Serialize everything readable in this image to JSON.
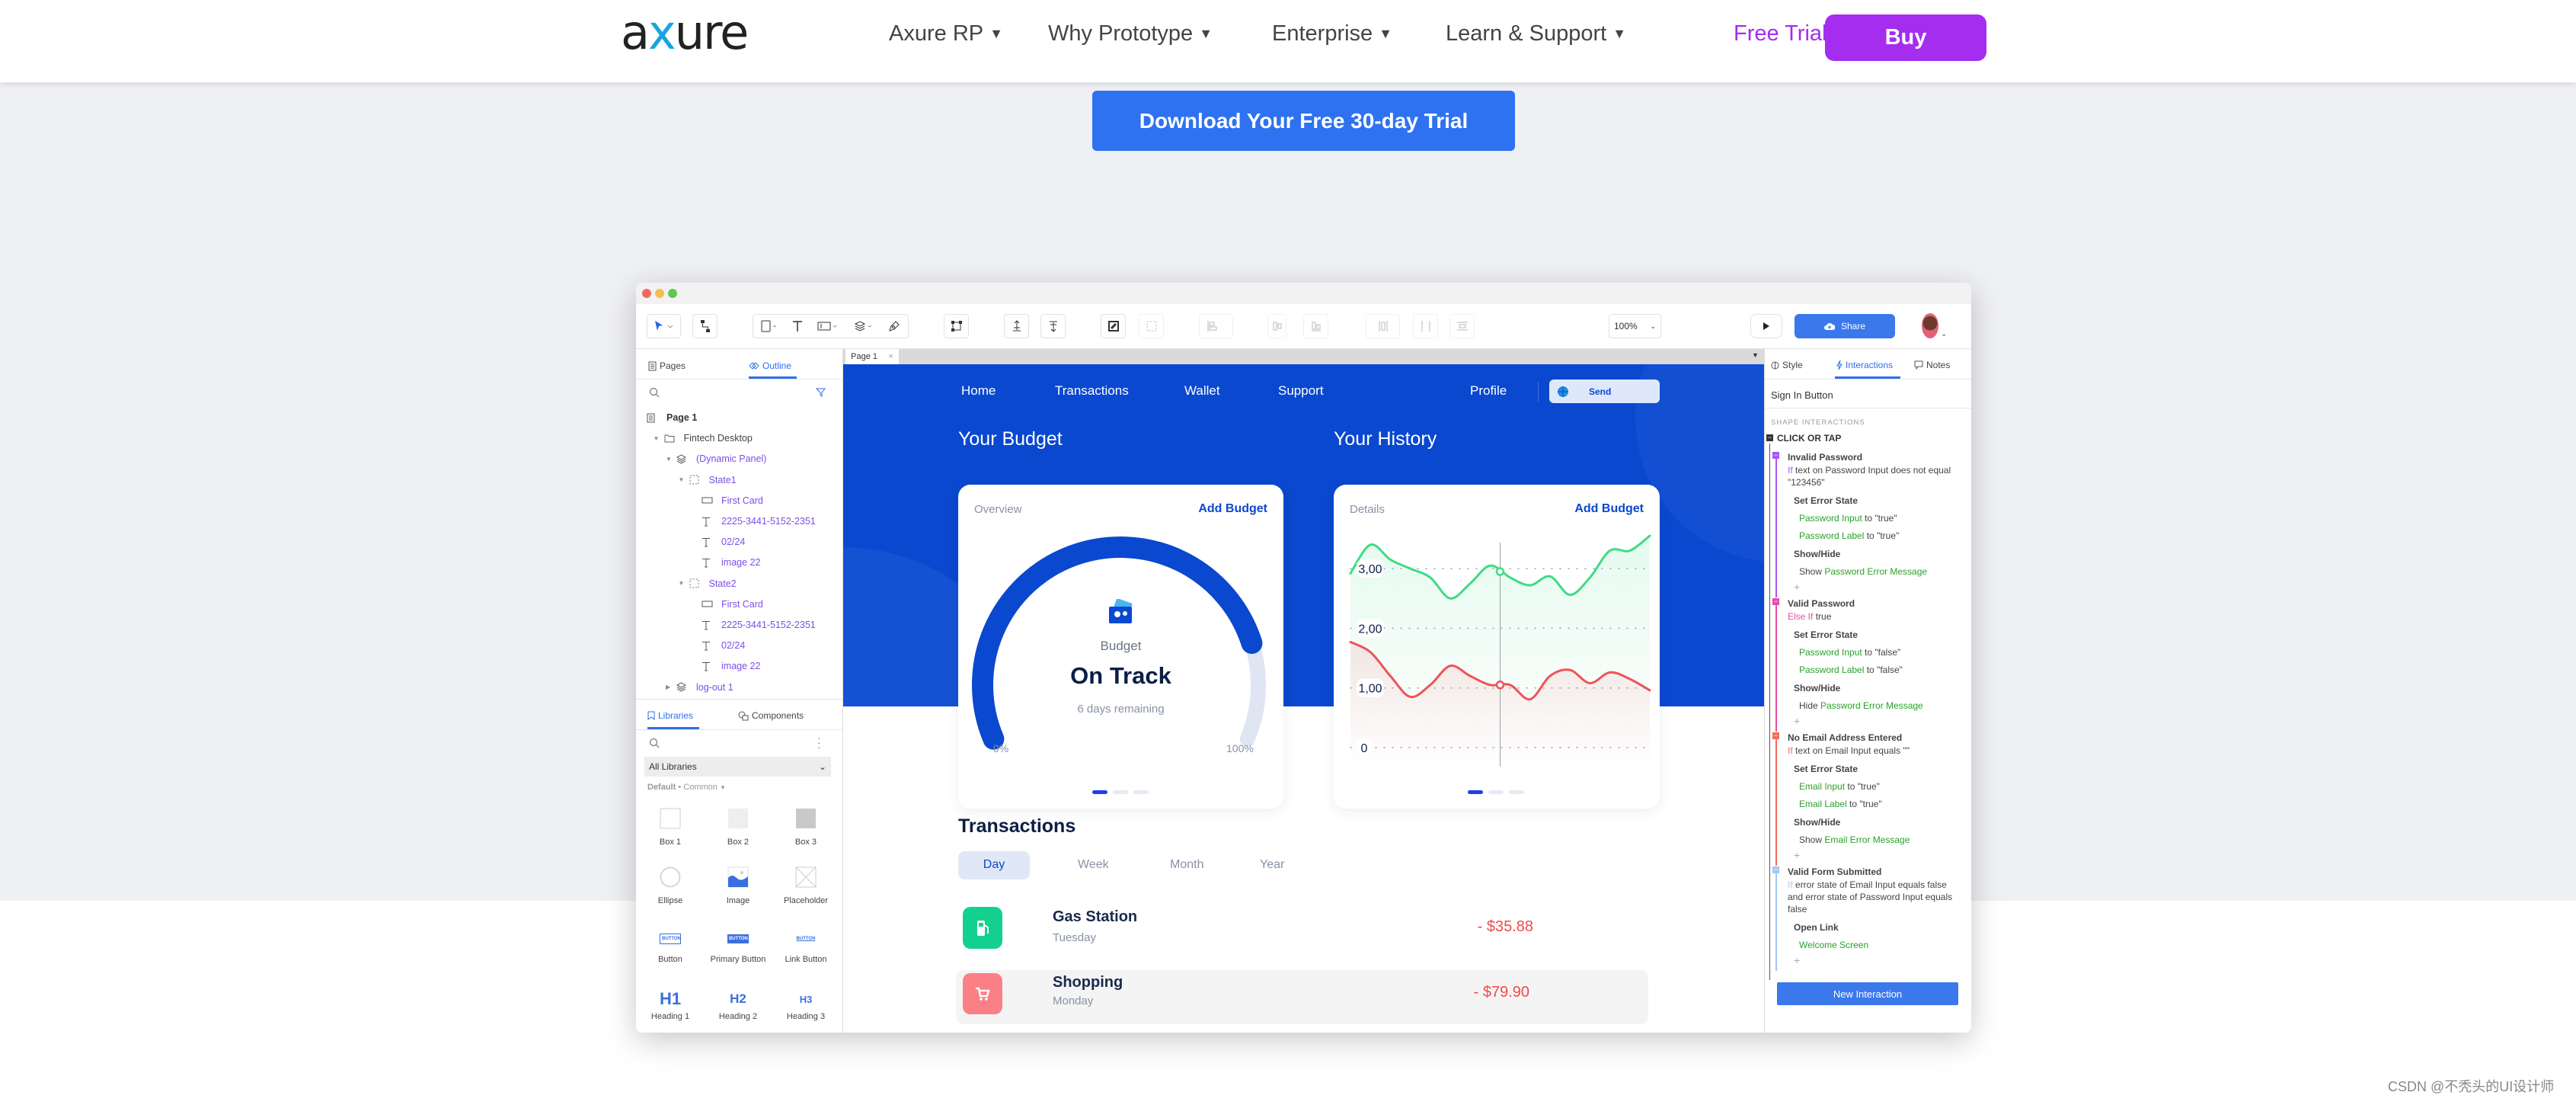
{
  "site": {
    "logo": "axure",
    "nav": [
      {
        "label": "Axure RP"
      },
      {
        "label": "Why Prototype"
      },
      {
        "label": "Enterprise"
      },
      {
        "label": "Learn & Support"
      }
    ],
    "free_trial": "Free Trial",
    "buy": "Buy",
    "cta": "Download Your Free 30-day Trial",
    "watermark": "CSDN @不秃头的UI设计师",
    "colors": {
      "brand_purple": "#a42df0",
      "cta_blue": "#2e72f2",
      "hero_bg": "#eff0f3"
    }
  },
  "app": {
    "toolbar": {
      "zoom": "100%",
      "share": "Share"
    },
    "left": {
      "tabs": [
        "Pages",
        "Outline"
      ],
      "active_tab": "Outline",
      "outline": [
        {
          "label": "Page 1",
          "level": 0,
          "icon": "page",
          "style": "bold"
        },
        {
          "label": "Fintech Desktop",
          "level": 1,
          "icon": "folder",
          "style": "plain",
          "expand": "open"
        },
        {
          "label": "(Dynamic Panel)",
          "level": 2,
          "icon": "layers",
          "style": "link",
          "expand": "open"
        },
        {
          "label": "State1",
          "level": 3,
          "icon": "state",
          "style": "link",
          "expand": "open"
        },
        {
          "label": "First Card",
          "level": 4,
          "icon": "rect",
          "style": "link"
        },
        {
          "label": "2225-3441-5152-2351",
          "level": 4,
          "icon": "text",
          "style": "link"
        },
        {
          "label": "02/24",
          "level": 4,
          "icon": "text",
          "style": "link"
        },
        {
          "label": "image 22",
          "level": 4,
          "icon": "text",
          "style": "link"
        },
        {
          "label": "State2",
          "level": 3,
          "icon": "state",
          "style": "link",
          "expand": "open"
        },
        {
          "label": "First Card",
          "level": 4,
          "icon": "rect",
          "style": "link"
        },
        {
          "label": "2225-3441-5152-2351",
          "level": 4,
          "icon": "text",
          "style": "link"
        },
        {
          "label": "02/24",
          "level": 4,
          "icon": "text",
          "style": "link"
        },
        {
          "label": "image 22",
          "level": 4,
          "icon": "text",
          "style": "link"
        },
        {
          "label": "log-out 1",
          "level": 2,
          "icon": "layers",
          "style": "link",
          "expand": "closed"
        }
      ],
      "lib_tabs": [
        "Libraries",
        "Components"
      ],
      "library_select": "All Libraries",
      "library_filter": {
        "default": "Default",
        "common": "Common"
      },
      "widgets": [
        {
          "label": "Box 1",
          "icon": "box-outline"
        },
        {
          "label": "Box 2",
          "icon": "box-light"
        },
        {
          "label": "Box 3",
          "icon": "box-gray"
        },
        {
          "label": "Ellipse",
          "icon": "ellipse"
        },
        {
          "label": "Image",
          "icon": "image"
        },
        {
          "label": "Placeholder",
          "icon": "placeholder"
        },
        {
          "label": "Button",
          "icon": "button",
          "glyph": "BUTTON"
        },
        {
          "label": "Primary Button",
          "icon": "primary-button",
          "glyph": "BUTTON"
        },
        {
          "label": "Link Button",
          "icon": "link-button",
          "glyph": "BUTTON"
        },
        {
          "label": "Heading 1",
          "icon": "h1",
          "glyph": "H1"
        },
        {
          "label": "Heading 2",
          "icon": "h2",
          "glyph": "H2"
        },
        {
          "label": "Heading 3",
          "icon": "h3",
          "glyph": "H3"
        }
      ]
    },
    "canvas": {
      "tab": "Page 1",
      "nav": [
        "Home",
        "Transactions",
        "Wallet",
        "Support"
      ],
      "profile": "Profile",
      "send": "Send",
      "budget": {
        "title": "Your Budget",
        "subtitle": "Overview",
        "action": "Add Budget",
        "label": "Budget",
        "status": "On Track",
        "remaining": "6 days remaining",
        "min": "0%",
        "max": "100%",
        "progress": 0.82
      },
      "history": {
        "title": "Your History",
        "subtitle": "Details",
        "action": "Add Budget"
      },
      "transactions": {
        "title": "Transactions",
        "tabs": [
          "Day",
          "Week",
          "Month",
          "Year"
        ],
        "active_tab": "Day",
        "items": [
          {
            "name": "Gas Station",
            "day": "Tuesday",
            "amount": "- $35.88",
            "icon": "fuel-pump",
            "color": "#12d18e"
          },
          {
            "name": "Shopping",
            "day": "Monday",
            "amount": "- $79.90",
            "icon": "shopping-cart",
            "color": "#fb7f86"
          }
        ]
      },
      "colors": {
        "primary": "#0a48cf",
        "dark_text": "#1a2a4c",
        "negative": "#ee4b4b"
      }
    },
    "right": {
      "tabs": [
        "Style",
        "Interactions",
        "Notes"
      ],
      "active_tab": "Interactions",
      "selected": "Sign In Button",
      "section": "SHAPE INTERACTIONS",
      "event": "CLICK OR TAP",
      "cases": [
        {
          "name": "Invalid Password",
          "color": "#a855f7",
          "keyword": "If",
          "condition": "text on Password Input does not equal \"123456\"",
          "actions": [
            {
              "name": "Set Error State",
              "items": [
                {
                  "prefix": "",
                  "target": "Password Input",
                  "suffix": " to \"true\""
                },
                {
                  "prefix": "",
                  "target": "Password Label",
                  "suffix": " to \"true\""
                }
              ]
            },
            {
              "name": "Show/Hide",
              "items": [
                {
                  "prefix": "Show ",
                  "target": "Password Error Message",
                  "suffix": ""
                }
              ]
            }
          ]
        },
        {
          "name": "Valid Password",
          "color": "#e64ea8",
          "keyword": "Else If",
          "condition": "true",
          "actions": [
            {
              "name": "Set Error State",
              "items": [
                {
                  "prefix": "",
                  "target": "Password Input",
                  "suffix": " to \"false\""
                },
                {
                  "prefix": "",
                  "target": "Password Label",
                  "suffix": " to \"false\""
                }
              ]
            },
            {
              "name": "Show/Hide",
              "items": [
                {
                  "prefix": "Hide ",
                  "target": "Password Error Message",
                  "suffix": ""
                }
              ]
            }
          ]
        },
        {
          "name": "No Email Address Entered",
          "color": "#f26b5b",
          "keyword": "If",
          "condition": "text on Email Input equals \"\"",
          "actions": [
            {
              "name": "Set Error State",
              "items": [
                {
                  "prefix": "",
                  "target": "Email Input",
                  "suffix": " to \"true\""
                },
                {
                  "prefix": "",
                  "target": "Email Label",
                  "suffix": " to \"true\""
                }
              ]
            },
            {
              "name": "Show/Hide",
              "items": [
                {
                  "prefix": "Show ",
                  "target": "Email Error Message",
                  "suffix": ""
                }
              ]
            }
          ]
        },
        {
          "name": "Valid Form Submitted",
          "color": "#a5c8f5",
          "keyword": "If",
          "condition": "error state of Email Input equals false and error state of Password Input equals false",
          "actions": [
            {
              "name": "Open Link",
              "items": [
                {
                  "prefix": "",
                  "target": "Welcome Screen",
                  "suffix": ""
                }
              ]
            }
          ]
        }
      ],
      "add_glyph": "+",
      "new_button": "New Interaction"
    }
  },
  "chart_data": {
    "type": "line",
    "title": "",
    "xlabel": "",
    "ylabel": "",
    "yticks": [
      "0",
      "1,00",
      "2,00",
      "3,00"
    ],
    "ytick_values": [
      0,
      1,
      2,
      3
    ],
    "ylim": [
      0,
      3.6
    ],
    "grid": true,
    "series": [
      {
        "color": "#3ddc84",
        "values": [
          2.92,
          3.4,
          3.15,
          3.0,
          2.85,
          2.5,
          2.75,
          3.05,
          2.85,
          2.72,
          2.87,
          2.56,
          2.85,
          3.3,
          3.3,
          3.55
        ]
      },
      {
        "color": "#f0525a",
        "values": [
          1.77,
          1.6,
          1.2,
          0.85,
          1.05,
          1.37,
          1.2,
          1.05,
          1.05,
          0.81,
          1.2,
          1.3,
          1.08,
          1.26,
          1.15,
          0.96
        ]
      }
    ],
    "cursor_index": 7.5
  }
}
